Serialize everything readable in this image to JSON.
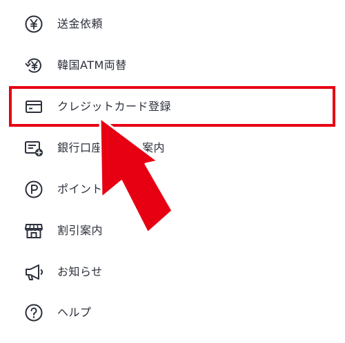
{
  "menu": {
    "items": [
      {
        "label": "送金依頼",
        "icon": "yen-circle-icon"
      },
      {
        "label": "韓国ATM両替",
        "icon": "currency-exchange-icon"
      },
      {
        "label": "クレジットカード登録",
        "icon": "credit-card-icon"
      },
      {
        "label": "銀行口座",
        "label_tail": "案内",
        "icon": "bank-account-add-icon"
      },
      {
        "label": "ポイント",
        "icon": "point-icon"
      },
      {
        "label": "割引案内",
        "icon": "store-icon"
      },
      {
        "label": "お知らせ",
        "icon": "megaphone-icon"
      },
      {
        "label": "ヘルプ",
        "icon": "help-icon"
      }
    ]
  },
  "annotation": {
    "highlight_color": "#e60012",
    "arrow_color": "#e60012"
  },
  "colors": {
    "text": "#2b2f3b",
    "background": "#ffffff"
  }
}
